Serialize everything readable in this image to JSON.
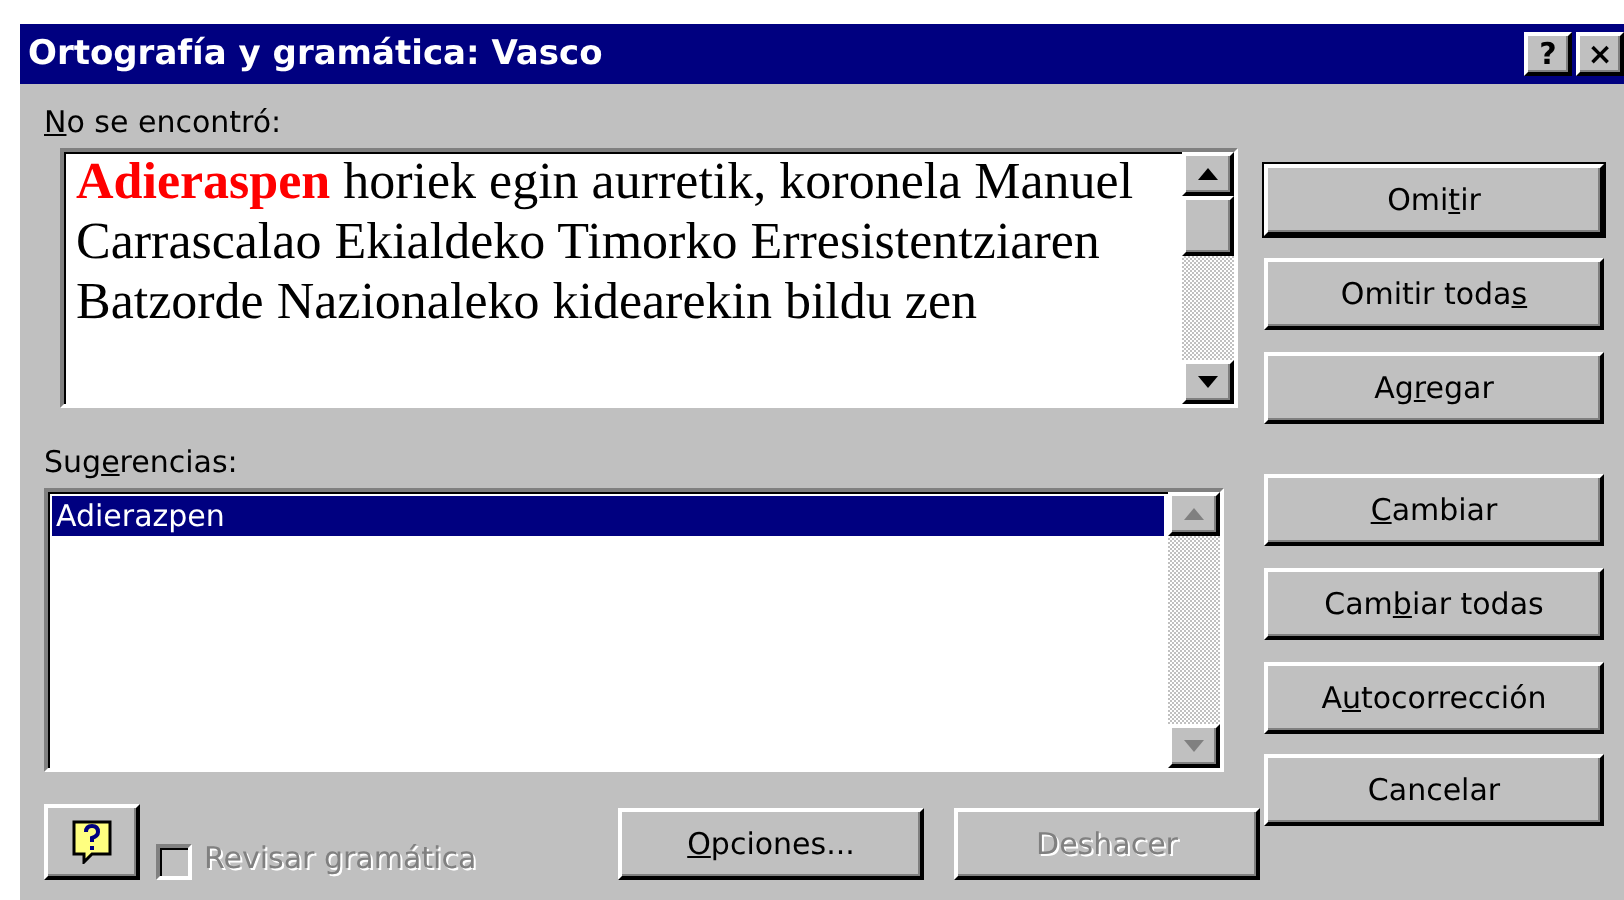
{
  "window": {
    "title": "Ortografía y gramática: Vasco",
    "title_buttons": [
      "?",
      "×"
    ]
  },
  "not_found": {
    "label": {
      "key": "N",
      "after": "o se encontró:"
    },
    "text": "**Adieraspen** horiek egin aurretik, koronela Manuel Carrascalao Ekialdeko Timorko Erresistentziaren Batzorde Nazionaleko kidearekin bildu zen"
  },
  "suggestions": {
    "label": {
      "before": "Sug",
      "key": "e",
      "after": "rencias:"
    },
    "items": [
      {
        "text": "Adierazpen",
        "selected": true
      }
    ]
  },
  "button_groups": [
    [
      {
        "label": {
          "before": "Omi",
          "key": "t",
          "after": "ir"
        },
        "default": true
      },
      {
        "label": {
          "before": "Omitir toda",
          "key": "s"
        },
        "default": false
      },
      {
        "label": {
          "before": "Ag",
          "key": "r",
          "after": "egar"
        },
        "default": false
      }
    ],
    [
      {
        "label": {
          "key": "C",
          "after": "ambiar"
        },
        "default": false
      },
      {
        "label": {
          "before": "Cam",
          "key": "b",
          "after": "iar todas"
        },
        "default": false
      },
      {
        "label": {
          "before": "A",
          "key": "u",
          "after": "tocorrección"
        },
        "default": false
      }
    ],
    [
      {
        "label": {
          "before": "Cancelar"
        },
        "default": false
      }
    ]
  ],
  "grammar_check": {
    "label": "Revisar gramática",
    "checked": false,
    "disabled": true
  },
  "bottom_buttons": [
    {
      "label": {
        "key": "O",
        "after": "pciones..."
      },
      "disabled": false
    },
    {
      "label": {
        "before": "Deshacer"
      },
      "disabled": true
    }
  ]
}
